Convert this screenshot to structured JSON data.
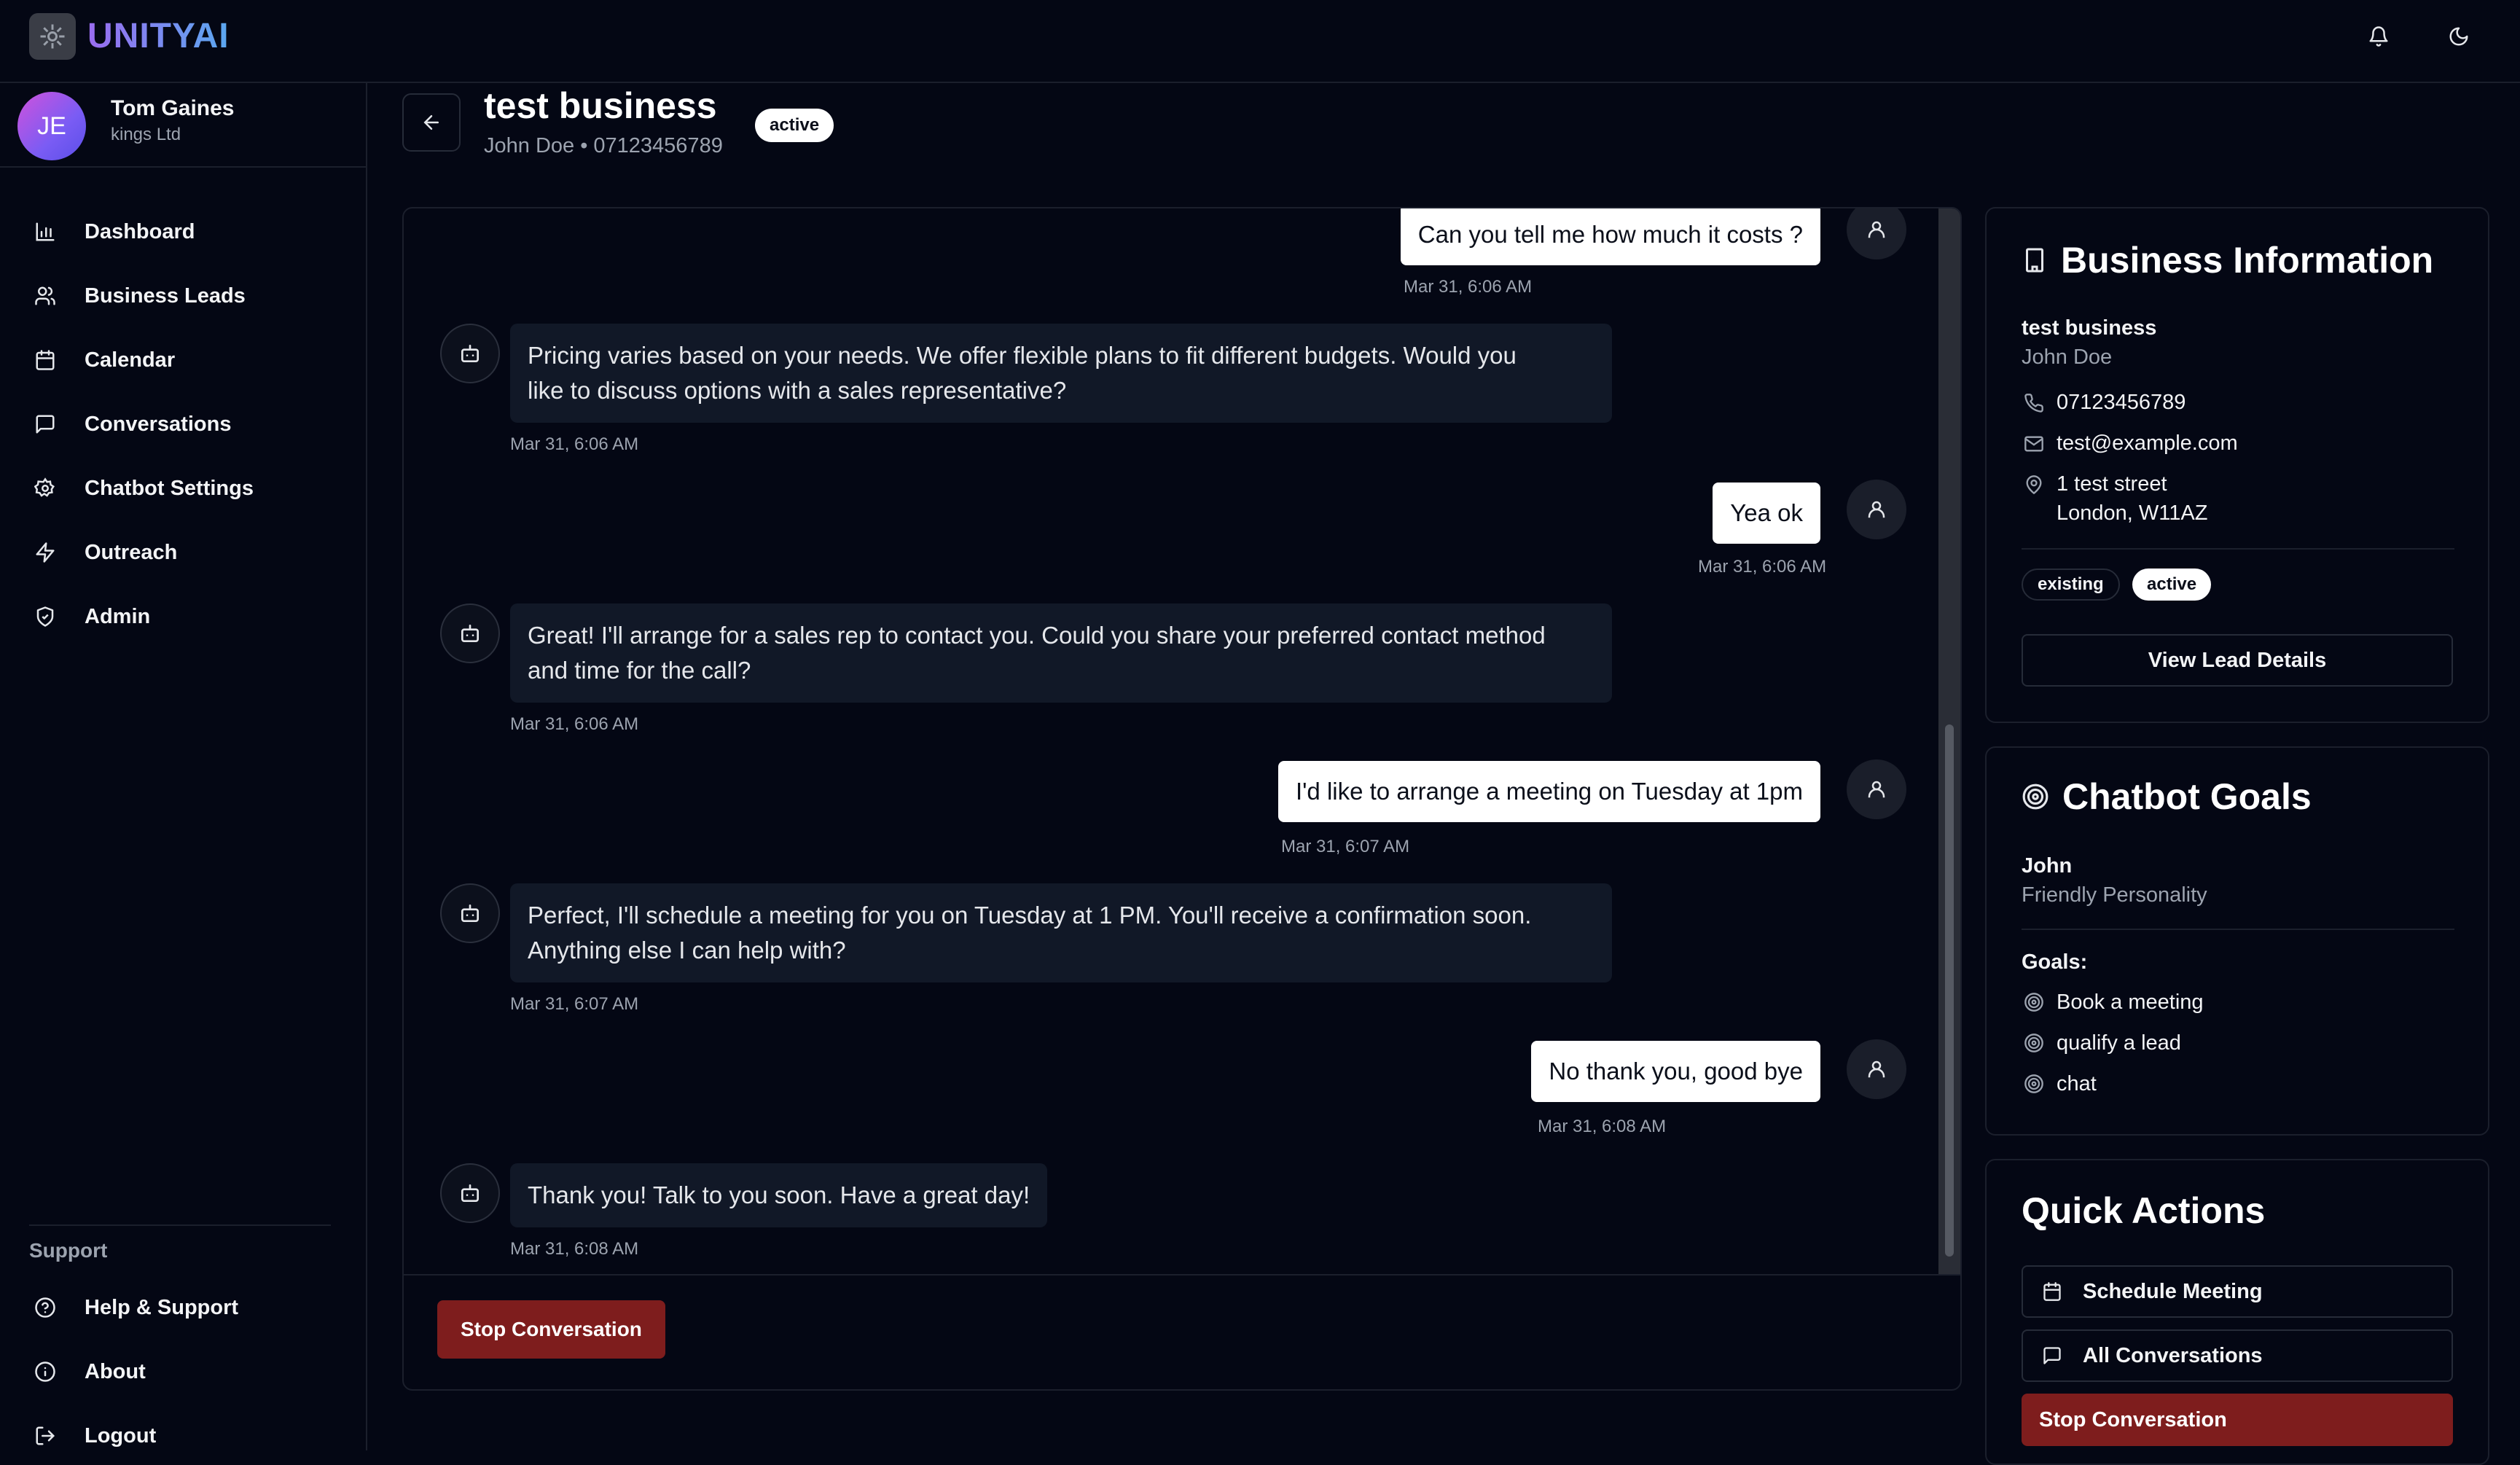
{
  "app": {
    "brand": "UNITYAI"
  },
  "user": {
    "initials": "JE",
    "name": "Tom Gaines",
    "company": "kings Ltd"
  },
  "sidebar": {
    "items": [
      {
        "label": "Dashboard",
        "icon": "bar-chart-icon"
      },
      {
        "label": "Business Leads",
        "icon": "users-icon"
      },
      {
        "label": "Calendar",
        "icon": "calendar-icon"
      },
      {
        "label": "Conversations",
        "icon": "message-icon"
      },
      {
        "label": "Chatbot Settings",
        "icon": "gear-icon"
      },
      {
        "label": "Outreach",
        "icon": "lightning-icon"
      },
      {
        "label": "Admin",
        "icon": "shield-icon"
      }
    ],
    "support_label": "Support",
    "support_items": [
      {
        "label": "Help & Support",
        "icon": "help-circle-icon"
      },
      {
        "label": "About",
        "icon": "info-icon"
      },
      {
        "label": "Logout",
        "icon": "logout-icon"
      }
    ]
  },
  "header": {
    "title": "test business",
    "subtitle": "John Doe • 07123456789",
    "status": "active"
  },
  "chat": {
    "messages": [
      {
        "role": "user",
        "text": "Can you tell me how much it costs ?",
        "time": "Mar 31, 6:06 AM"
      },
      {
        "role": "bot",
        "lines": [
          "Pricing varies based on your needs. We offer flexible plans to fit different budgets. Would you",
          "like to discuss options with a sales representative?"
        ],
        "time": "Mar 31, 6:06 AM"
      },
      {
        "role": "user",
        "text": "Yea ok",
        "time": "Mar 31, 6:06 AM"
      },
      {
        "role": "bot",
        "lines": [
          "Great! I'll arrange for a sales rep to contact you. Could you share your preferred contact method",
          "and time for the call?"
        ],
        "time": "Mar 31, 6:06 AM"
      },
      {
        "role": "user",
        "text": "I'd like to arrange a meeting on Tuesday at 1pm",
        "time": "Mar 31, 6:07 AM"
      },
      {
        "role": "bot",
        "lines": [
          "Perfect, I'll schedule a meeting for you on Tuesday at 1 PM. You'll receive a confirmation soon.",
          "Anything else I can help with?"
        ],
        "time": "Mar 31, 6:07 AM"
      },
      {
        "role": "user",
        "text": "No thank you, good bye",
        "time": "Mar 31, 6:08 AM"
      },
      {
        "role": "bot",
        "lines": [
          "Thank you! Talk to you soon. Have a great day!"
        ],
        "time": "Mar 31, 6:08 AM"
      }
    ],
    "stop_label": "Stop Conversation"
  },
  "business_info": {
    "title": "Business Information",
    "name": "test business",
    "contact": "John Doe",
    "phone": "07123456789",
    "email": "test@example.com",
    "address_line1": "1 test street",
    "address_line2": "London, W11AZ",
    "badges": [
      "existing",
      "active"
    ],
    "view_label": "View Lead Details"
  },
  "chatbot_goals": {
    "title": "Chatbot Goals",
    "bot_name": "John",
    "personality": "Friendly Personality",
    "goals_label": "Goals:",
    "goals": [
      "Book a meeting",
      "qualify a lead",
      "chat"
    ]
  },
  "quick_actions": {
    "title": "Quick Actions",
    "schedule_label": "Schedule Meeting",
    "all_conversations_label": "All Conversations",
    "stop_label": "Stop Conversation"
  }
}
